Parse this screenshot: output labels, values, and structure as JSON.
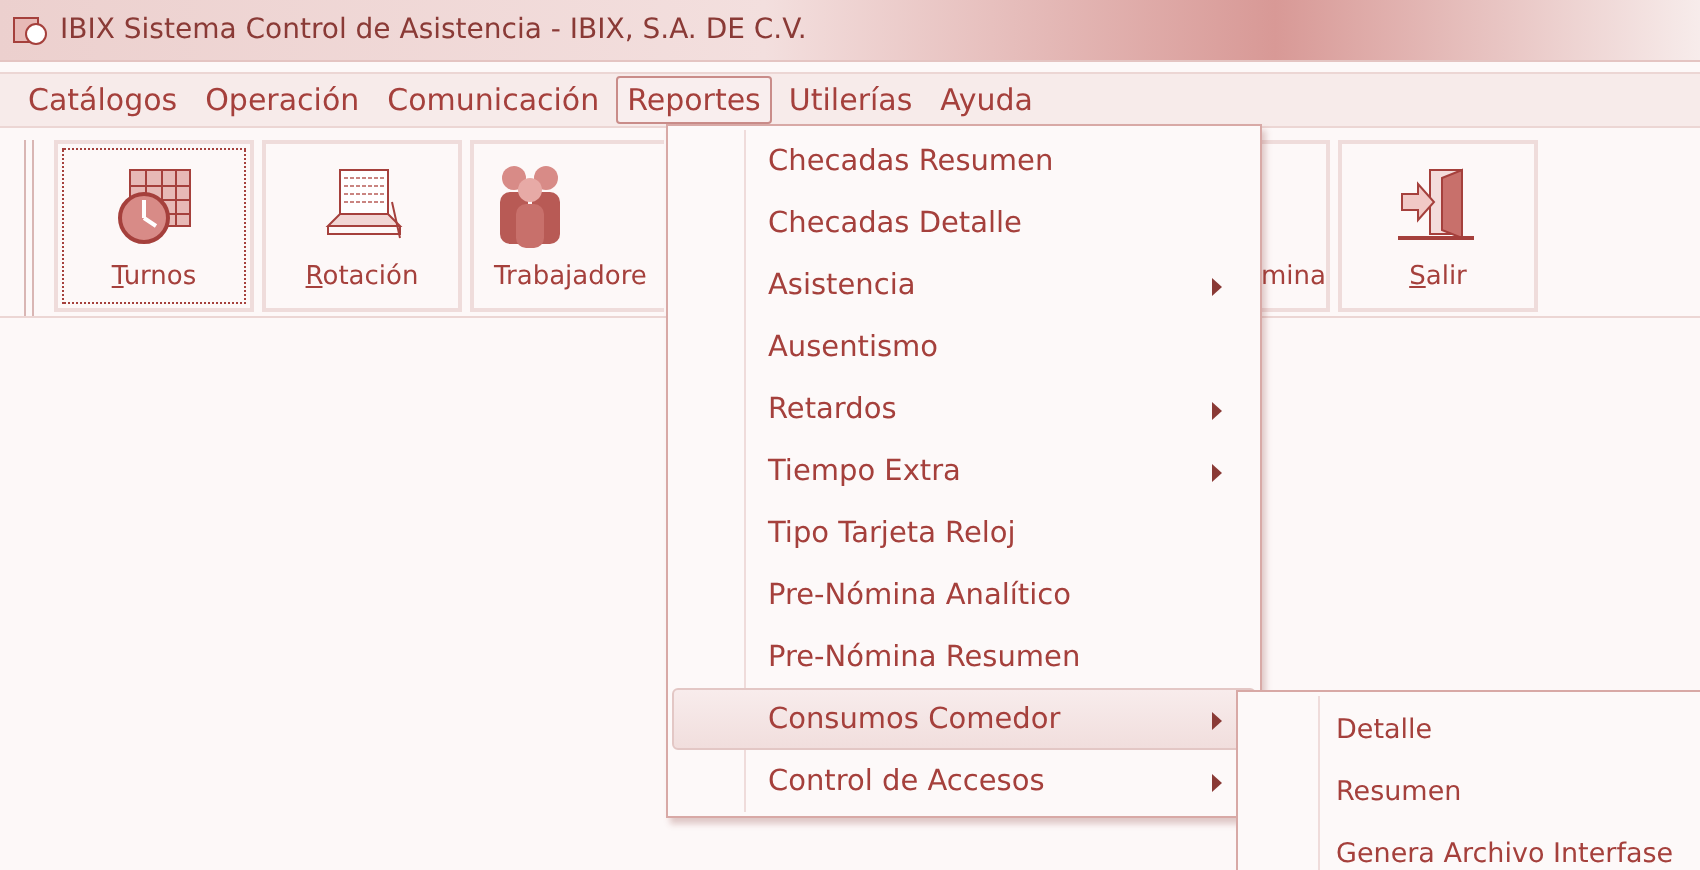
{
  "window": {
    "title": "IBIX Sistema Control de Asistencia - IBIX, S.A. DE C.V."
  },
  "menu_bar": [
    {
      "label": "Catálogos",
      "selected": false
    },
    {
      "label": "Operación",
      "selected": false
    },
    {
      "label": "Comunicación",
      "selected": false
    },
    {
      "label": "Reportes",
      "selected": true
    },
    {
      "label": "Utilerías",
      "selected": false
    },
    {
      "label": "Ayuda",
      "selected": false
    }
  ],
  "toolbar": [
    {
      "label": "Turnos",
      "kind": "calendar-clock",
      "focused": true,
      "clipped": false
    },
    {
      "label": "Rotación",
      "kind": "calendar",
      "focused": false,
      "clipped": false
    },
    {
      "label": "Trabajadore",
      "kind": "people",
      "focused": false,
      "clipped": true
    },
    {
      "label": "mina",
      "kind": "partial",
      "focused": false,
      "clipped": true
    },
    {
      "label": "Salir",
      "kind": "exit",
      "focused": false,
      "clipped": false
    }
  ],
  "menu": [
    {
      "label": "Checadas Resumen",
      "submenu": false,
      "selected": false
    },
    {
      "label": "Checadas Detalle",
      "submenu": false,
      "selected": false
    },
    {
      "label": "Asistencia",
      "submenu": true,
      "selected": false
    },
    {
      "label": "Ausentismo",
      "submenu": false,
      "selected": false
    },
    {
      "label": "Retardos",
      "submenu": true,
      "selected": false
    },
    {
      "label": "Tiempo Extra",
      "submenu": true,
      "selected": false
    },
    {
      "label": "Tipo Tarjeta Reloj",
      "submenu": false,
      "selected": false
    },
    {
      "label": "Pre-Nómina Analítico",
      "submenu": false,
      "selected": false
    },
    {
      "label": "Pre-Nómina Resumen",
      "submenu": false,
      "selected": false
    },
    {
      "label": "Consumos Comedor",
      "submenu": true,
      "selected": true
    },
    {
      "label": "Control de Accesos",
      "submenu": true,
      "selected": false
    }
  ],
  "submenu": [
    {
      "label": "Detalle"
    },
    {
      "label": "Resumen"
    },
    {
      "label": "Genera Archivo Interfase"
    }
  ]
}
